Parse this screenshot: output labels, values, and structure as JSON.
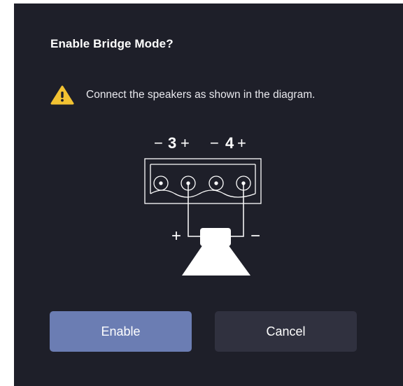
{
  "dialog": {
    "title": "Enable Bridge Mode?",
    "warning_icon": "warning-triangle-icon",
    "warning_color": "#f2c232",
    "message": "Connect the speakers as shown in the diagram.",
    "diagram": {
      "channel_3": {
        "minus": "−",
        "number": "3",
        "plus": "+"
      },
      "channel_4": {
        "minus": "−",
        "number": "4",
        "plus": "+"
      },
      "speaker_plus": "+",
      "speaker_minus": "−"
    },
    "enable_label": "Enable",
    "cancel_label": "Cancel",
    "enable_color": "#6b7db3",
    "cancel_color": "#30313f",
    "background_color": "#1e1f29"
  }
}
